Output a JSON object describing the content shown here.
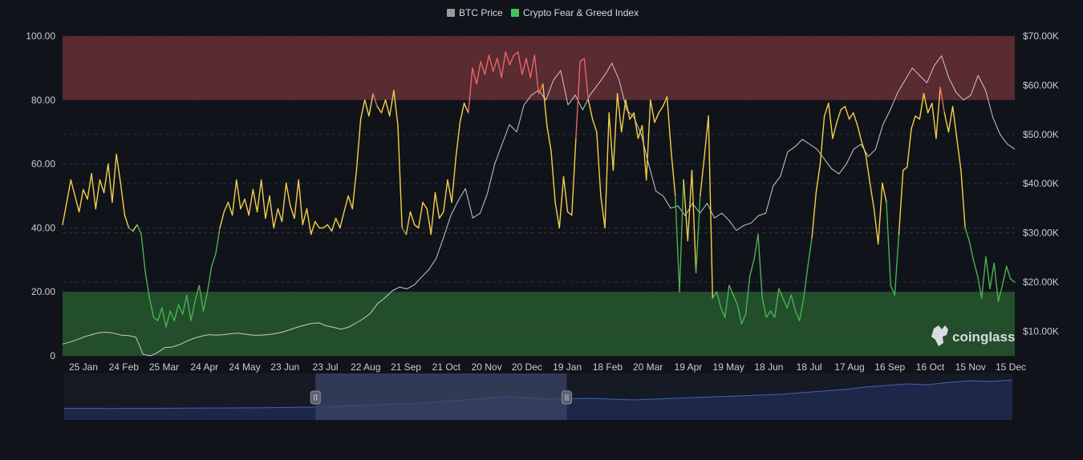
{
  "legend": {
    "btc_price": "BTC Price",
    "fear_greed": "Crypto Fear & Greed Index"
  },
  "watermark": "coinglass",
  "colors": {
    "background": "#11131a",
    "greed_zone": "#5a2b30",
    "fear_zone": "#234e2c",
    "greed_line": "#e9636b",
    "neutral_line": "#f2cf4a",
    "fear_line": "#48b34f",
    "btc_line": "#c9c9c9",
    "btc_legend": "#9a9a9a",
    "fg_legend": "#3fc45a",
    "grid": "#2f333c",
    "navigator_fill": "#1e2748",
    "navigator_line": "#3d63b8",
    "navigator_selected": "#3b4566"
  },
  "chart_data": {
    "type": "line",
    "x_tick_labels": [
      "25 Jan",
      "24 Feb",
      "25 Mar",
      "24 Apr",
      "24 May",
      "23 Jun",
      "23 Jul",
      "22 Aug",
      "21 Sep",
      "21 Oct",
      "20 Nov",
      "20 Dec",
      "19 Jan",
      "18 Feb",
      "20 Mar",
      "19 Apr",
      "19 May",
      "18 Jun",
      "18 Jul",
      "17 Aug",
      "16 Sep",
      "16 Oct",
      "15 Nov",
      "15 Dec"
    ],
    "y_left": {
      "ylim": [
        0,
        100
      ],
      "ticks": [
        "0",
        "20.00",
        "40.00",
        "60.00",
        "80.00",
        "100.00"
      ]
    },
    "y_right": {
      "ylim": [
        5000,
        70000
      ],
      "ticks": [
        "$10.00K",
        "$20.00K",
        "$30.00K",
        "$40.00K",
        "$50.00K",
        "$60.00K",
        "$70.00K"
      ]
    },
    "zones": [
      {
        "name": "greed",
        "from": 80,
        "to": 100
      },
      {
        "name": "fear",
        "from": 0,
        "to": 20
      }
    ],
    "thresholds": {
      "greed": 80,
      "fear": 40
    },
    "series": [
      {
        "name": "Crypto Fear & Greed Index",
        "axis": "left",
        "values": [
          41,
          48,
          55,
          50,
          45,
          52,
          49,
          57,
          46,
          55,
          51,
          60,
          48,
          63,
          54,
          44,
          40,
          39,
          41,
          38,
          26,
          18,
          12,
          11,
          15,
          9,
          14,
          11,
          16,
          13,
          19,
          11,
          17,
          22,
          14,
          20,
          28,
          32,
          40,
          45,
          48,
          44,
          55,
          46,
          49,
          44,
          52,
          45,
          55,
          43,
          50,
          40,
          46,
          42,
          54,
          47,
          43,
          55,
          41,
          46,
          38,
          42,
          40,
          40,
          41,
          39,
          43,
          40,
          45,
          50,
          46,
          58,
          74,
          80,
          75,
          82,
          78,
          76,
          80,
          75,
          83,
          72,
          40,
          38,
          45,
          41,
          40,
          48,
          46,
          38,
          51,
          43,
          45,
          55,
          48,
          62,
          73,
          79,
          76,
          90,
          85,
          92,
          88,
          94,
          89,
          93,
          87,
          95,
          91,
          94,
          95,
          88,
          93,
          87,
          94,
          82,
          85,
          72,
          64,
          48,
          40,
          56,
          45,
          44,
          68,
          92,
          93,
          80,
          74,
          70,
          50,
          40,
          76,
          58,
          82,
          70,
          80,
          74,
          76,
          68,
          72,
          55,
          80,
          73,
          76,
          78,
          81,
          64,
          50,
          20,
          55,
          36,
          58,
          26,
          50,
          62,
          75,
          18,
          20,
          15,
          12,
          22,
          19,
          16,
          10,
          13,
          25,
          30,
          38,
          18,
          12,
          14,
          12,
          21,
          18,
          15,
          19,
          14,
          11,
          18,
          28,
          37,
          51,
          60,
          75,
          79,
          68,
          73,
          77,
          78,
          74,
          76,
          72,
          67,
          63,
          54,
          46,
          35,
          54,
          48,
          22,
          19,
          38,
          58,
          59,
          71,
          75,
          74,
          82,
          76,
          79,
          68,
          84,
          76,
          70,
          78,
          68,
          58,
          40,
          36,
          30,
          25,
          18,
          31,
          21,
          29,
          17,
          22,
          28,
          24,
          23
        ]
      },
      {
        "name": "BTC Price",
        "axis": "right",
        "values": [
          7400,
          7800,
          8300,
          8900,
          9300,
          9700,
          9800,
          9600,
          9200,
          9100,
          8800,
          5300,
          5000,
          5700,
          6700,
          6800,
          7300,
          8000,
          8600,
          9000,
          9300,
          9200,
          9300,
          9500,
          9600,
          9400,
          9200,
          9200,
          9300,
          9500,
          9800,
          10300,
          10800,
          11200,
          11600,
          11700,
          11100,
          10800,
          10400,
          10800,
          11600,
          12500,
          13600,
          15600,
          16800,
          18200,
          19000,
          18600,
          19400,
          21000,
          22500,
          24800,
          29000,
          33500,
          36500,
          39000,
          33000,
          34000,
          38000,
          44000,
          48000,
          52000,
          50500,
          56000,
          58000,
          59000,
          57000,
          61000,
          63000,
          56000,
          58000,
          55000,
          58000,
          60000,
          62000,
          64500,
          61000,
          55000,
          53500,
          50000,
          44000,
          38500,
          37500,
          35000,
          35500,
          33500,
          36000,
          34000,
          36000,
          33000,
          34000,
          32500,
          30500,
          31500,
          32000,
          33500,
          34000,
          39500,
          41500,
          46500,
          47500,
          49000,
          48000,
          47000,
          45000,
          43000,
          42000,
          44000,
          47000,
          48000,
          45500,
          47000,
          52000,
          55000,
          58500,
          61000,
          63500,
          62000,
          60500,
          64000,
          66000,
          61500,
          58500,
          57000,
          58000,
          62000,
          59000,
          53500,
          50000,
          48000,
          47000
        ]
      }
    ],
    "navigator": {
      "selected_range": [
        0.265,
        0.53
      ],
      "series": [
        5,
        4.8,
        4.6,
        4.7,
        4.9,
        5.2,
        5.4,
        5.7,
        6,
        6.3,
        6.8,
        7.5,
        8.5,
        10,
        12,
        14,
        16,
        18,
        22,
        26,
        30,
        34,
        31,
        28,
        29,
        30,
        28,
        26,
        28,
        30,
        32,
        34,
        36,
        38,
        40,
        44,
        48,
        52,
        58,
        62,
        66,
        64,
        70,
        74,
        72,
        76
      ]
    }
  }
}
